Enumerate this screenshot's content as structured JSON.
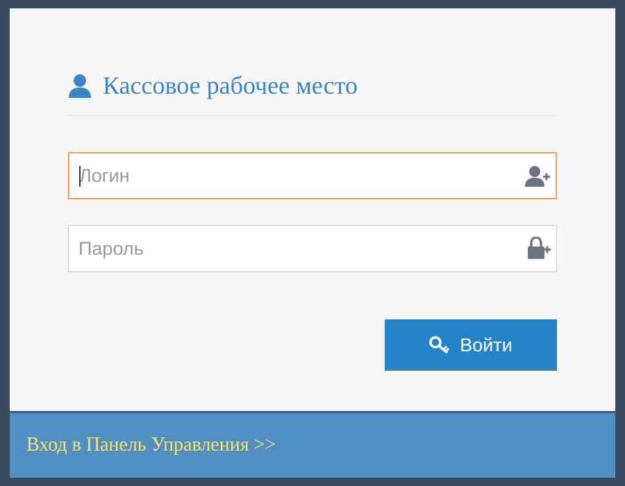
{
  "header": {
    "title": "Кассовое рабочее место",
    "icon": "user-icon"
  },
  "form": {
    "login": {
      "placeholder": "Логин",
      "value": "",
      "focused": true,
      "icon": "user-add-icon"
    },
    "password": {
      "placeholder": "Пароль",
      "value": "",
      "icon": "lock-icon"
    },
    "submit": {
      "label": "Войти",
      "icon": "key-icon"
    }
  },
  "footer": {
    "link_label": "Вход в Панель Управления >>"
  },
  "colors": {
    "background": "#3a4a5e",
    "panel": "#f6f6f6",
    "accent": "#2584c7",
    "title": "#3e84c4",
    "focus_border": "#f0a050",
    "footer": "#4f8fc2",
    "footer_link": "#f5e27a"
  }
}
